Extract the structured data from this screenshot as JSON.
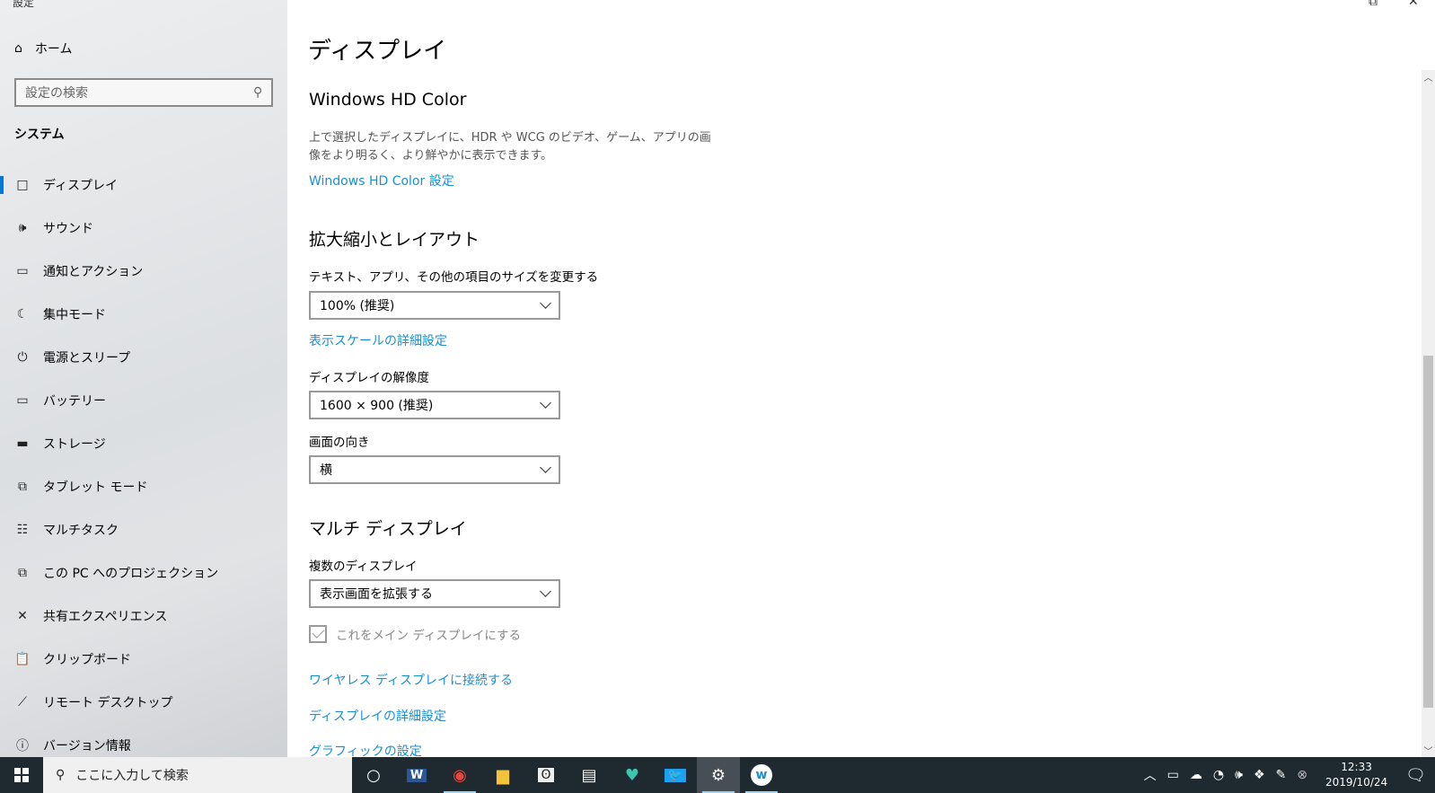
{
  "window": {
    "title": "設定",
    "restore_icon": "restore-icon",
    "close_icon": "close-icon"
  },
  "sidebar": {
    "home": "ホーム",
    "search_placeholder": "設定の検索",
    "section": "システム",
    "items": [
      {
        "label": "ディスプレイ",
        "icon": "□"
      },
      {
        "label": "サウンド",
        "icon": "🕪"
      },
      {
        "label": "通知とアクション",
        "icon": "▭"
      },
      {
        "label": "集中モード",
        "icon": "☾"
      },
      {
        "label": "電源とスリープ",
        "icon": "⏻"
      },
      {
        "label": "バッテリー",
        "icon": "▭"
      },
      {
        "label": "ストレージ",
        "icon": "▬"
      },
      {
        "label": "タブレット モード",
        "icon": "⧉"
      },
      {
        "label": "マルチタスク",
        "icon": "☷"
      },
      {
        "label": "この PC へのプロジェクション",
        "icon": "⧉"
      },
      {
        "label": "共有エクスペリエンス",
        "icon": "✕"
      },
      {
        "label": "クリップボード",
        "icon": "📋"
      },
      {
        "label": "リモート デスクトップ",
        "icon": "⟋"
      },
      {
        "label": "バージョン情報",
        "icon": "ⓘ"
      }
    ]
  },
  "main": {
    "title": "ディスプレイ",
    "hdr": {
      "heading": "Windows HD Color",
      "desc": "上で選択したディスプレイに、HDR や WCG のビデオ、ゲーム、アプリの画像をより明るく、より鮮やかに表示できます。",
      "link": "Windows HD Color 設定"
    },
    "scale": {
      "heading": "拡大縮小とレイアウト",
      "size_label": "テキスト、アプリ、その他の項目のサイズを変更する",
      "size_value": "100% (推奨)",
      "advanced_link": "表示スケールの詳細設定",
      "resolution_label": "ディスプレイの解像度",
      "resolution_value": "1600 × 900 (推奨)",
      "orientation_label": "画面の向き",
      "orientation_value": "横"
    },
    "multi": {
      "heading": "マルチ ディスプレイ",
      "label": "複数のディスプレイ",
      "value": "表示画面を拡張する",
      "main_checkbox": "これをメイン ディスプレイにする",
      "main_checked": true,
      "wireless_link": "ワイヤレス ディスプレイに接続する",
      "advanced_link": "ディスプレイの詳細設定",
      "graphics_link": "グラフィックの設定"
    }
  },
  "taskbar": {
    "search_placeholder": "ここに入力して検索",
    "time": "12:33",
    "date": "2019/10/24",
    "apps": [
      "cortana",
      "word",
      "chrome",
      "explorer",
      "app",
      "film",
      "app2",
      "twitter",
      "settings",
      "w-app"
    ]
  },
  "colors": {
    "accent": "#0078d7",
    "link": "#1b8fd1",
    "taskbar": "#1f2a30"
  }
}
